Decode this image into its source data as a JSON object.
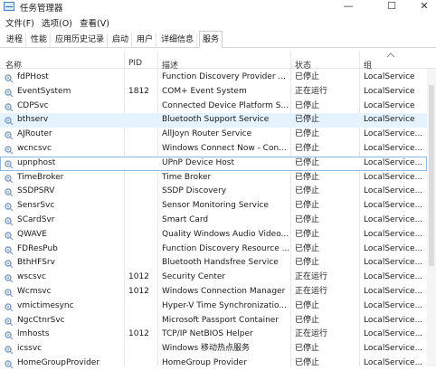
{
  "window": {
    "title": "任务管理器"
  },
  "controls": {
    "minimize": "—",
    "maximize": "☐",
    "close": "✕"
  },
  "menu": [
    "文件(F)",
    "选项(O)",
    "查看(V)"
  ],
  "tabs": [
    "进程",
    "性能",
    "应用历史记录",
    "启动",
    "用户",
    "详细信息",
    "服务"
  ],
  "active_tab": "服务",
  "columns": {
    "name": "名称",
    "pid": "PID",
    "desc": "描述",
    "status": "状态",
    "group": "组"
  },
  "colors": {
    "hover_row": "#e5f3ff",
    "selected_border": "#8fb9e0",
    "gear": "#7b9bc4"
  },
  "services": [
    {
      "name": "fdPHost",
      "pid": "",
      "desc": "Function Discovery Provider ...",
      "status": "已停止",
      "group": "LocalService"
    },
    {
      "name": "EventSystem",
      "pid": "1812",
      "desc": "COM+ Event System",
      "status": "正在运行",
      "group": "LocalService"
    },
    {
      "name": "CDPSvc",
      "pid": "",
      "desc": "Connected Device Platform S...",
      "status": "已停止",
      "group": "LocalService"
    },
    {
      "name": "bthserv",
      "pid": "",
      "desc": "Bluetooth Support Service",
      "status": "已停止",
      "group": "LocalService"
    },
    {
      "name": "AJRouter",
      "pid": "",
      "desc": "AllJoyn Router Service",
      "status": "已停止",
      "group": "LocalService..."
    },
    {
      "name": "wcncsvc",
      "pid": "",
      "desc": "Windows Connect Now - Con...",
      "status": "已停止",
      "group": "LocalService..."
    },
    {
      "name": "upnphost",
      "pid": "",
      "desc": "UPnP Device Host",
      "status": "已停止",
      "group": "LocalService..."
    },
    {
      "name": "TimeBroker",
      "pid": "",
      "desc": "Time Broker",
      "status": "已停止",
      "group": "LocalService..."
    },
    {
      "name": "SSDPSRV",
      "pid": "",
      "desc": "SSDP Discovery",
      "status": "已停止",
      "group": "LocalService..."
    },
    {
      "name": "SensrSvc",
      "pid": "",
      "desc": "Sensor Monitoring Service",
      "status": "已停止",
      "group": "LocalService..."
    },
    {
      "name": "SCardSvr",
      "pid": "",
      "desc": "Smart Card",
      "status": "已停止",
      "group": "LocalService..."
    },
    {
      "name": "QWAVE",
      "pid": "",
      "desc": "Quality Windows Audio Video...",
      "status": "已停止",
      "group": "LocalService..."
    },
    {
      "name": "FDResPub",
      "pid": "",
      "desc": "Function Discovery Resource ...",
      "status": "已停止",
      "group": "LocalService..."
    },
    {
      "name": "BthHFSrv",
      "pid": "",
      "desc": "Bluetooth Handsfree Service",
      "status": "已停止",
      "group": "LocalService..."
    },
    {
      "name": "wscsvc",
      "pid": "1012",
      "desc": "Security Center",
      "status": "正在运行",
      "group": "LocalService..."
    },
    {
      "name": "Wcmsvc",
      "pid": "1012",
      "desc": "Windows Connection Manager",
      "status": "正在运行",
      "group": "LocalService..."
    },
    {
      "name": "vmictimesync",
      "pid": "",
      "desc": "Hyper-V Time Synchronizatio...",
      "status": "已停止",
      "group": "LocalService..."
    },
    {
      "name": "NgcCtnrSvc",
      "pid": "",
      "desc": "Microsoft Passport Container",
      "status": "已停止",
      "group": "LocalService..."
    },
    {
      "name": "lmhosts",
      "pid": "1012",
      "desc": "TCP/IP NetBIOS Helper",
      "status": "正在运行",
      "group": "LocalService..."
    },
    {
      "name": "icssvc",
      "pid": "",
      "desc": "Windows 移动热点服务",
      "status": "已停止",
      "group": "LocalService..."
    },
    {
      "name": "HomeGroupProvider",
      "pid": "",
      "desc": "HomeGroup Provider",
      "status": "已停止",
      "group": "LocalService..."
    }
  ]
}
